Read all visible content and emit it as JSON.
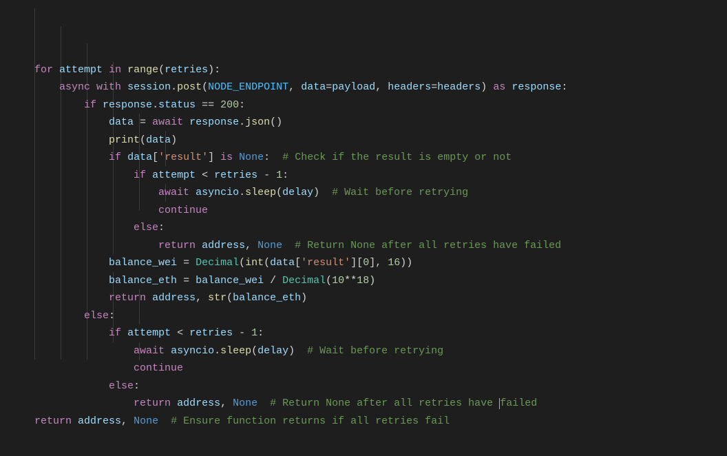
{
  "code": {
    "tokens": [
      [
        [
          "kw",
          "for"
        ],
        [
          "op",
          " "
        ],
        [
          "var",
          "attempt"
        ],
        [
          "op",
          " "
        ],
        [
          "kw",
          "in"
        ],
        [
          "op",
          " "
        ],
        [
          "fn",
          "range"
        ],
        [
          "op",
          "("
        ],
        [
          "var",
          "retries"
        ],
        [
          "op",
          "):"
        ]
      ],
      [
        [
          "kw",
          "async"
        ],
        [
          "op",
          " "
        ],
        [
          "kw",
          "with"
        ],
        [
          "op",
          " "
        ],
        [
          "var",
          "session"
        ],
        [
          "op",
          "."
        ],
        [
          "fn",
          "post"
        ],
        [
          "op",
          "("
        ],
        [
          "const",
          "NODE_ENDPOINT"
        ],
        [
          "op",
          ", "
        ],
        [
          "var",
          "data"
        ],
        [
          "op",
          "="
        ],
        [
          "var",
          "payload"
        ],
        [
          "op",
          ", "
        ],
        [
          "var",
          "headers"
        ],
        [
          "op",
          "="
        ],
        [
          "var",
          "headers"
        ],
        [
          "op",
          ") "
        ],
        [
          "kw",
          "as"
        ],
        [
          "op",
          " "
        ],
        [
          "var",
          "response"
        ],
        [
          "op",
          ":"
        ]
      ],
      [
        [
          "kw",
          "if"
        ],
        [
          "op",
          " "
        ],
        [
          "var",
          "response"
        ],
        [
          "op",
          "."
        ],
        [
          "var",
          "status"
        ],
        [
          "op",
          " == "
        ],
        [
          "num",
          "200"
        ],
        [
          "op",
          ":"
        ]
      ],
      [
        [
          "var",
          "data"
        ],
        [
          "op",
          " = "
        ],
        [
          "kw",
          "await"
        ],
        [
          "op",
          " "
        ],
        [
          "var",
          "response"
        ],
        [
          "op",
          "."
        ],
        [
          "fn",
          "json"
        ],
        [
          "op",
          "()"
        ]
      ],
      [
        [
          "fn",
          "print"
        ],
        [
          "op",
          "("
        ],
        [
          "var",
          "data"
        ],
        [
          "op",
          ")"
        ]
      ],
      [
        [
          "kw",
          "if"
        ],
        [
          "op",
          " "
        ],
        [
          "var",
          "data"
        ],
        [
          "op",
          "["
        ],
        [
          "str",
          "'result'"
        ],
        [
          "op",
          "] "
        ],
        [
          "kw",
          "is"
        ],
        [
          "op",
          " "
        ],
        [
          "builtin",
          "None"
        ],
        [
          "op",
          ":  "
        ],
        [
          "cmt",
          "# Check if the result is empty or not"
        ]
      ],
      [
        [
          "kw",
          "if"
        ],
        [
          "op",
          " "
        ],
        [
          "var",
          "attempt"
        ],
        [
          "op",
          " < "
        ],
        [
          "var",
          "retries"
        ],
        [
          "op",
          " - "
        ],
        [
          "num",
          "1"
        ],
        [
          "op",
          ":"
        ]
      ],
      [
        [
          "kw",
          "await"
        ],
        [
          "op",
          " "
        ],
        [
          "var",
          "asyncio"
        ],
        [
          "op",
          "."
        ],
        [
          "fn",
          "sleep"
        ],
        [
          "op",
          "("
        ],
        [
          "var",
          "delay"
        ],
        [
          "op",
          ")  "
        ],
        [
          "cmt",
          "# Wait before retrying"
        ]
      ],
      [
        [
          "kw",
          "continue"
        ]
      ],
      [
        [
          "kw",
          "else"
        ],
        [
          "op",
          ":"
        ]
      ],
      [
        [
          "kw",
          "return"
        ],
        [
          "op",
          " "
        ],
        [
          "var",
          "address"
        ],
        [
          "op",
          ", "
        ],
        [
          "builtin",
          "None"
        ],
        [
          "op",
          "  "
        ],
        [
          "cmt",
          "# Return None after all retries have failed"
        ]
      ],
      [
        [
          "var",
          "balance_wei"
        ],
        [
          "op",
          " = "
        ],
        [
          "cls",
          "Decimal"
        ],
        [
          "op",
          "("
        ],
        [
          "fn",
          "int"
        ],
        [
          "op",
          "("
        ],
        [
          "var",
          "data"
        ],
        [
          "op",
          "["
        ],
        [
          "str",
          "'result'"
        ],
        [
          "op",
          "]["
        ],
        [
          "num",
          "0"
        ],
        [
          "op",
          "], "
        ],
        [
          "num",
          "16"
        ],
        [
          "op",
          "))"
        ]
      ],
      [
        [
          "var",
          "balance_eth"
        ],
        [
          "op",
          " = "
        ],
        [
          "var",
          "balance_wei"
        ],
        [
          "op",
          " / "
        ],
        [
          "cls",
          "Decimal"
        ],
        [
          "op",
          "("
        ],
        [
          "num",
          "10"
        ],
        [
          "op",
          "**"
        ],
        [
          "num",
          "18"
        ],
        [
          "op",
          ")"
        ]
      ],
      [
        [
          "kw",
          "return"
        ],
        [
          "op",
          " "
        ],
        [
          "var",
          "address"
        ],
        [
          "op",
          ", "
        ],
        [
          "fn",
          "str"
        ],
        [
          "op",
          "("
        ],
        [
          "var",
          "balance_eth"
        ],
        [
          "op",
          ")"
        ]
      ],
      [
        [
          "kw",
          "else"
        ],
        [
          "op",
          ":"
        ]
      ],
      [
        [
          "kw",
          "if"
        ],
        [
          "op",
          " "
        ],
        [
          "var",
          "attempt"
        ],
        [
          "op",
          " < "
        ],
        [
          "var",
          "retries"
        ],
        [
          "op",
          " - "
        ],
        [
          "num",
          "1"
        ],
        [
          "op",
          ":"
        ]
      ],
      [
        [
          "kw",
          "await"
        ],
        [
          "op",
          " "
        ],
        [
          "var",
          "asyncio"
        ],
        [
          "op",
          "."
        ],
        [
          "fn",
          "sleep"
        ],
        [
          "op",
          "("
        ],
        [
          "var",
          "delay"
        ],
        [
          "op",
          ")  "
        ],
        [
          "cmt",
          "# Wait before retrying"
        ]
      ],
      [
        [
          "kw",
          "continue"
        ]
      ],
      [
        [
          "kw",
          "else"
        ],
        [
          "op",
          ":"
        ]
      ],
      [
        [
          "kw",
          "return"
        ],
        [
          "op",
          " "
        ],
        [
          "var",
          "address"
        ],
        [
          "op",
          ", "
        ],
        [
          "builtin",
          "None"
        ],
        [
          "op",
          "  "
        ],
        [
          "cmt",
          "# Return None after all retries have "
        ],
        [
          "cursor",
          ""
        ],
        [
          "cmt",
          "failed"
        ]
      ],
      [
        [
          "kw",
          "return"
        ],
        [
          "op",
          " "
        ],
        [
          "var",
          "address"
        ],
        [
          "op",
          ", "
        ],
        [
          "builtin",
          "None"
        ],
        [
          "op",
          "  "
        ],
        [
          "cmt",
          "# Ensure function returns if all retries fail"
        ]
      ]
    ],
    "indents": [
      0,
      1,
      2,
      3,
      3,
      3,
      4,
      5,
      5,
      4,
      5,
      3,
      3,
      3,
      2,
      3,
      4,
      4,
      3,
      4,
      0
    ]
  }
}
